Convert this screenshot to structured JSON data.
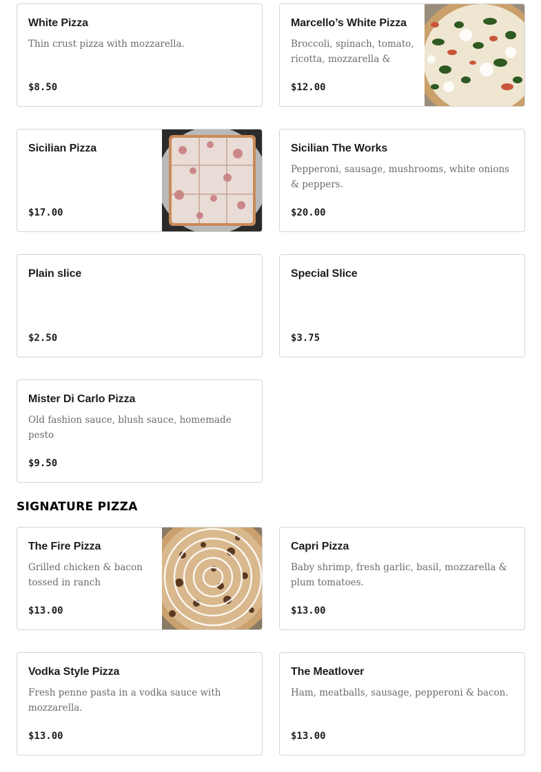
{
  "items": [
    {
      "name": "White Pizza",
      "desc": "Thin crust pizza with mozzarella.",
      "price": "$8.50"
    },
    {
      "name": "Marcello’s White Pizza",
      "desc": "Broccoli, spinach, tomato, ricotta, mozzarella & fres...",
      "price": "$12.00",
      "image": "white-pizza-photo"
    },
    {
      "name": "Sicilian Pizza",
      "desc": "",
      "price": "$17.00",
      "image": "sicilian-pizza-photo"
    },
    {
      "name": "Sicilian The Works",
      "desc": "Pepperoni, sausage, mushrooms, white onions & peppers.",
      "price": "$20.00"
    },
    {
      "name": "Plain slice",
      "desc": "",
      "price": "$2.50"
    },
    {
      "name": "Special Slice",
      "desc": "",
      "price": "$3.75"
    },
    {
      "name": "Mister Di Carlo Pizza",
      "desc": "Old fashion sauce, blush sauce, homemade pesto",
      "price": "$9.50"
    }
  ],
  "signature": {
    "heading": "SIGNATURE PIZZA",
    "items": [
      {
        "name": "The Fire Pizza",
        "desc": "Grilled chicken & bacon tossed in ranch dressing...",
        "price": "$13.00",
        "image": "fire-pizza-photo"
      },
      {
        "name": "Capri Pizza",
        "desc": "Baby shrimp, fresh garlic, basil, mozzarella & plum tomatoes.",
        "price": "$13.00"
      },
      {
        "name": "Vodka Style Pizza",
        "desc": "Fresh penne pasta in a vodka sauce with mozzarella.",
        "price": "$13.00"
      },
      {
        "name": "The Meatlover",
        "desc": "Ham, meatballs, sausage, pepperoni & bacon.",
        "price": "$13.00"
      }
    ]
  }
}
